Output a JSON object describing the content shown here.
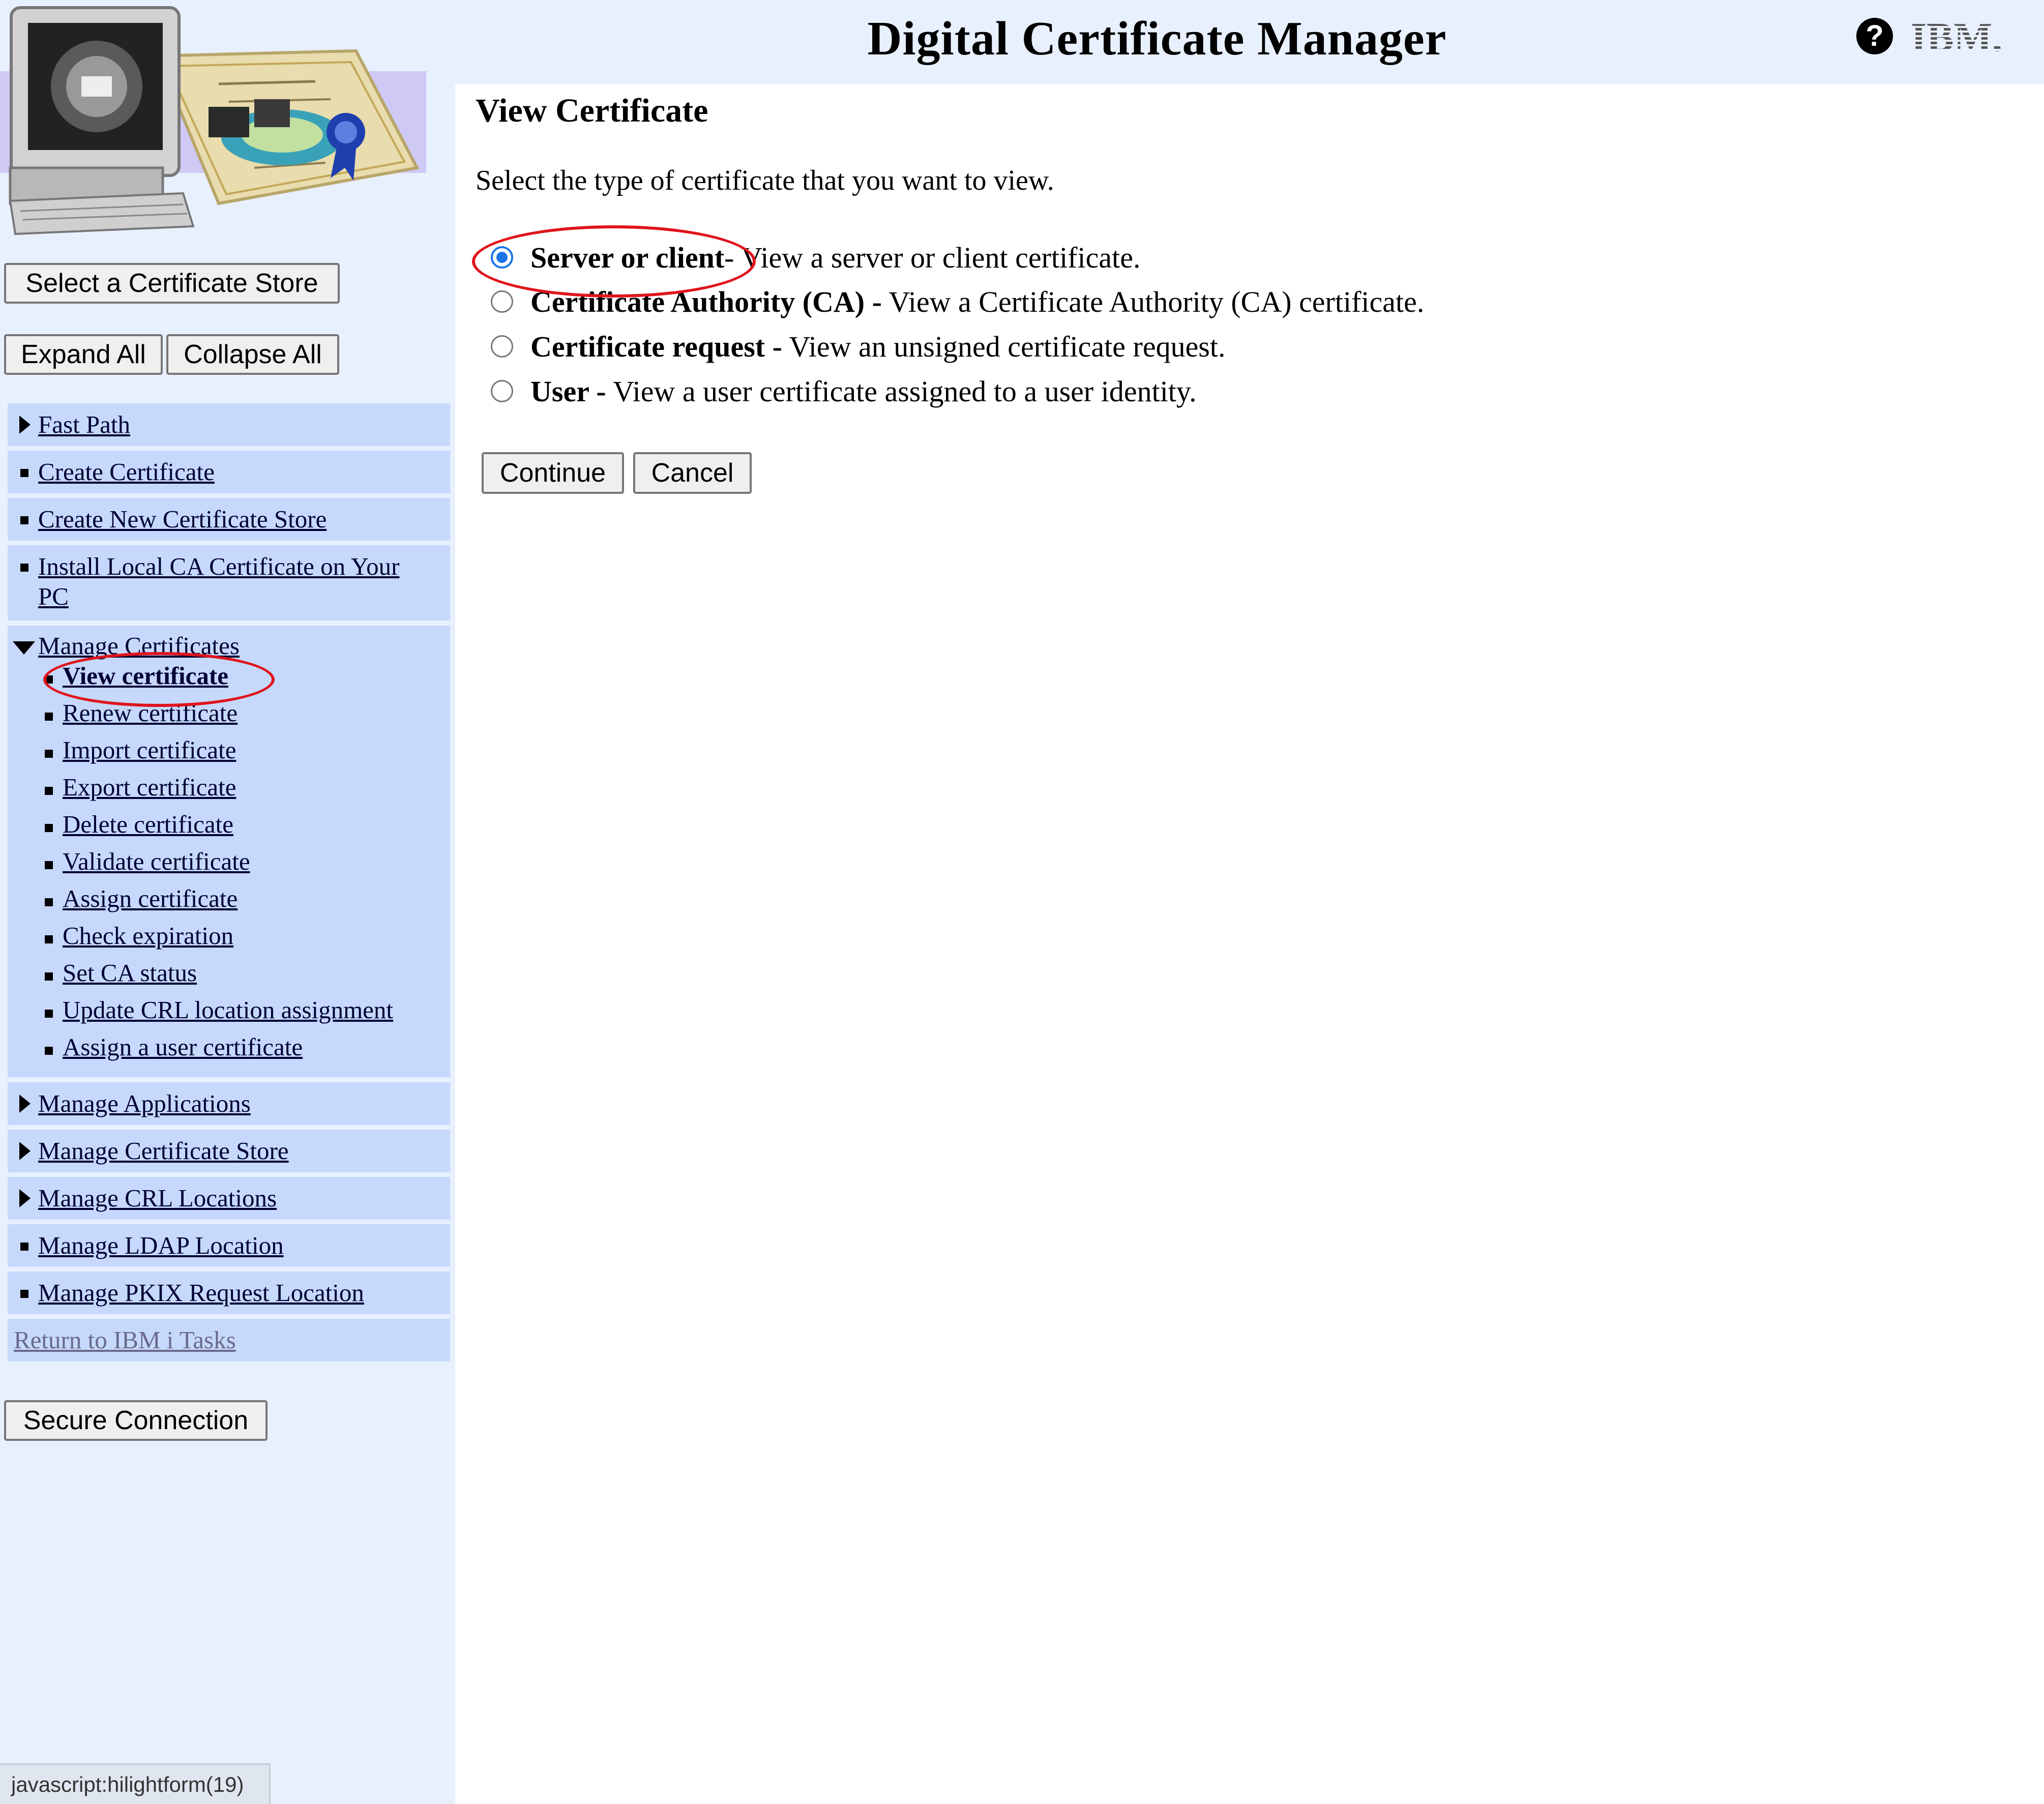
{
  "header": {
    "title": "Digital Certificate Manager",
    "ibm_logo": "IBM."
  },
  "sidebar": {
    "select_store_button": "Select a Certificate Store",
    "expand_all_button": "Expand All",
    "collapse_all_button": "Collapse All",
    "nav": {
      "fast_path": "Fast Path",
      "create_certificate": "Create Certificate",
      "create_new_store": "Create New Certificate Store",
      "install_local_ca_line1": "Install Local CA Certificate on Your",
      "install_local_ca_line2": "PC",
      "manage_certificates": "Manage Certificates",
      "manage_certificates_items": [
        "View certificate",
        "Renew certificate",
        "Import certificate",
        "Export certificate",
        "Delete certificate",
        "Validate certificate",
        "Assign certificate",
        "Check expiration",
        "Set CA status",
        "Update CRL location assignment",
        "Assign a user certificate"
      ],
      "manage_applications": "Manage Applications",
      "manage_certificate_store": "Manage Certificate Store",
      "manage_crl_locations": "Manage CRL Locations",
      "manage_ldap_location": "Manage LDAP Location",
      "manage_pkix_location": "Manage PKIX Request Location",
      "return_to_tasks": "Return to IBM i Tasks"
    },
    "secure_connection_button": "Secure Connection"
  },
  "main": {
    "heading": "View Certificate",
    "instructions": "Select the type of certificate that you want to view.",
    "options": [
      {
        "label": "Server or client",
        "description": "- View a server or client certificate.",
        "checked": true
      },
      {
        "label": "Certificate Authority (CA) -",
        "description": " View a Certificate Authority (CA) certificate.",
        "checked": false
      },
      {
        "label": "Certificate request -",
        "description": " View an unsigned certificate request.",
        "checked": false
      },
      {
        "label": "User -",
        "description": " View a user certificate assigned to a user identity.",
        "checked": false
      }
    ],
    "continue_button": "Continue",
    "cancel_button": "Cancel"
  },
  "statusbar": {
    "text": "javascript:hilightform(19)"
  },
  "colors": {
    "sidebar_bg": "#e8f0fe",
    "nav_block_bg": "#c6d9fd",
    "highlight_red": "#e0141c",
    "radio_checked": "#1a73e8"
  }
}
